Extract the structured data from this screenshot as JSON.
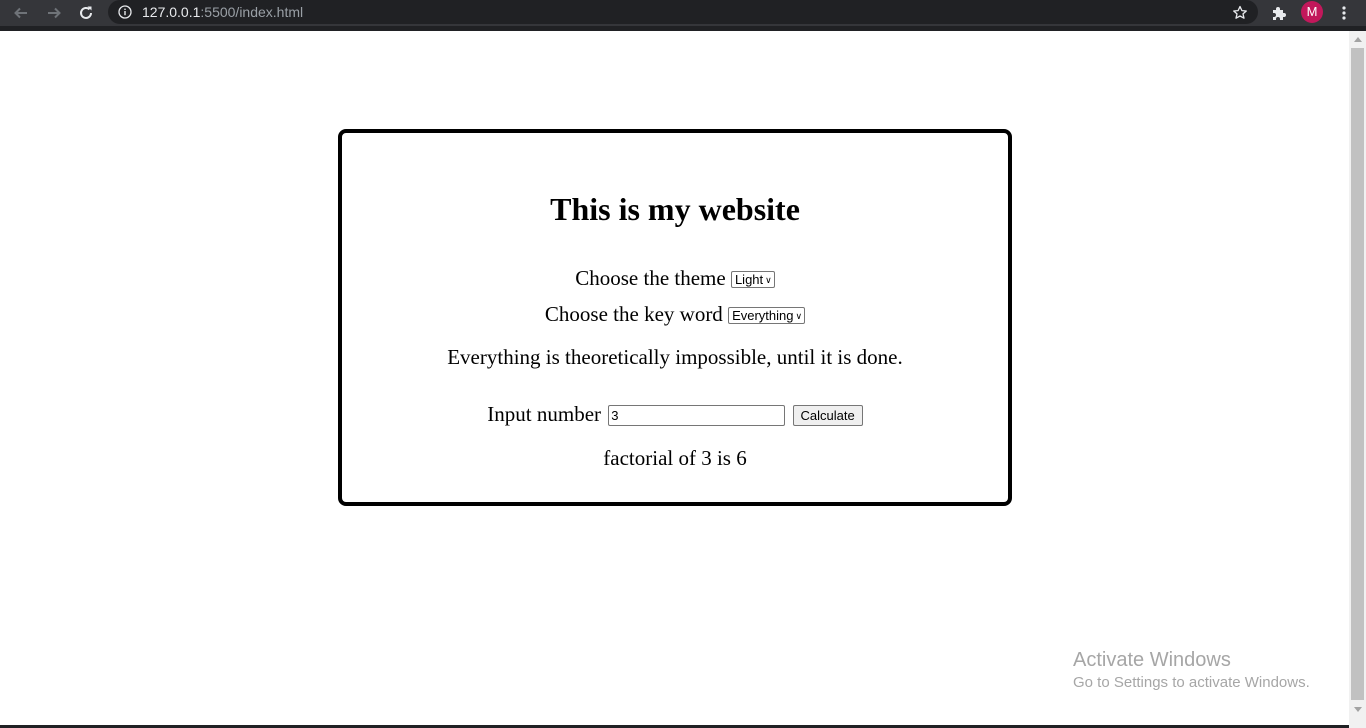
{
  "browser": {
    "url_host": "127.0.0.1",
    "url_rest": ":5500/index.html",
    "avatar_letter": "M",
    "avatar_color": "#c2185b"
  },
  "page": {
    "title": "This is my website",
    "theme_label": "Choose the theme",
    "theme_selected": "Light",
    "keyword_label": "Choose the key word",
    "keyword_selected": "Everything",
    "quote": "Everything is theoretically impossible, until it is done.",
    "input_label": "Input number",
    "input_value": "3",
    "calculate_label": "Calculate",
    "result": "factorial of 3 is 6"
  },
  "watermark": {
    "title": "Activate Windows",
    "subtitle": "Go to Settings to activate Windows."
  }
}
